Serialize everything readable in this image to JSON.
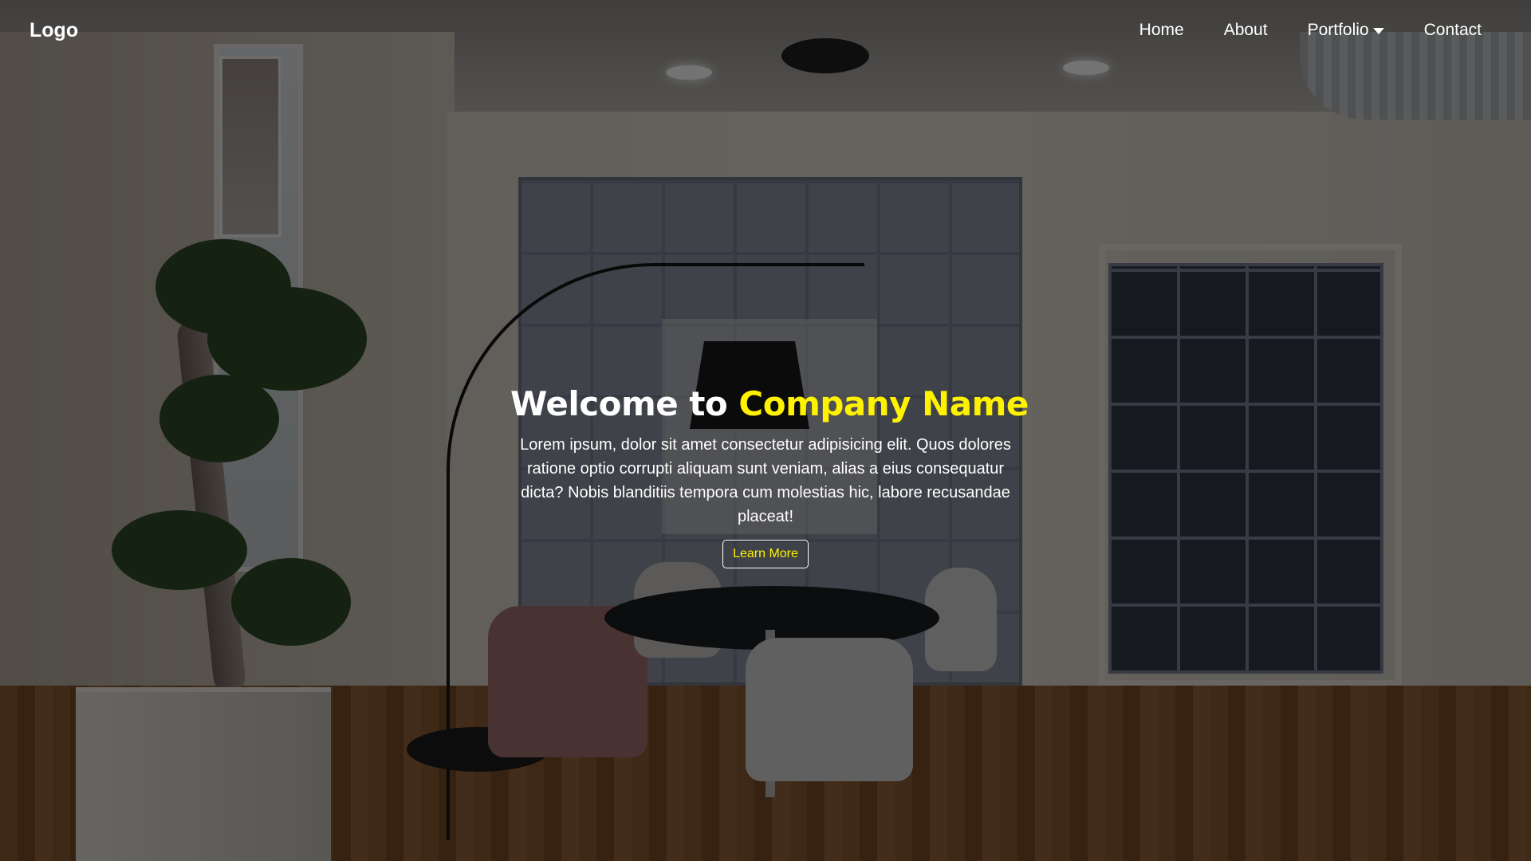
{
  "nav": {
    "logo": "Logo",
    "items": [
      {
        "label": "Home"
      },
      {
        "label": "About"
      },
      {
        "label": "Portfolio",
        "icon": "caret-down-icon"
      },
      {
        "label": "Contact"
      }
    ]
  },
  "hero": {
    "title_prefix": "Welcome to",
    "title_highlight": "Company Name",
    "description": "Lorem ipsum, dolor sit amet consectetur adipisicing elit. Quos dolores ratione optio corrupti aliquam sunt veniam, alias a eius consequatur dicta? Nobis blanditiis tempora cum molestias hic, labore recusandae placeat!",
    "button_label": "Learn More",
    "background_image": "office-meeting-room-photo"
  },
  "colors": {
    "accent": "#fff200",
    "text": "#ffffff",
    "overlay": "rgba(0,0,0,0.55)"
  }
}
